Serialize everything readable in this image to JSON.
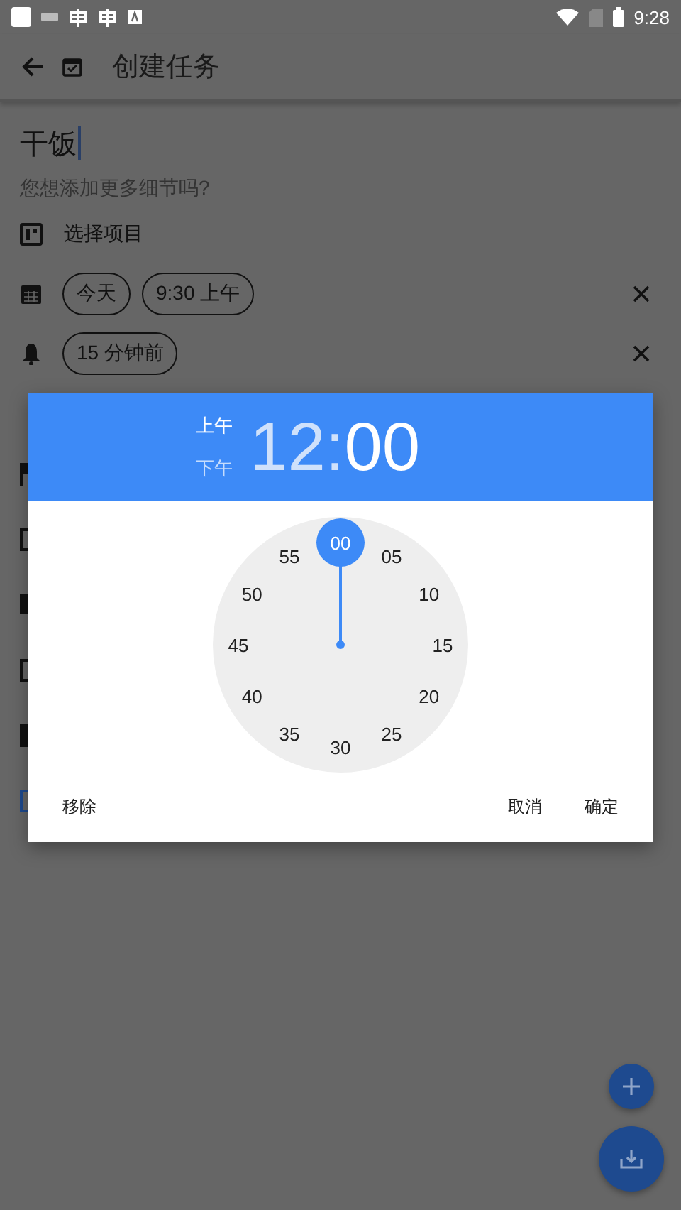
{
  "status_bar": {
    "time": "9:28"
  },
  "app_bar": {
    "title": "创建任务"
  },
  "task": {
    "title": "干饭",
    "notes_placeholder": "您想添加更多细节吗?"
  },
  "project": {
    "label": "选择项目"
  },
  "due": {
    "chips": [
      "今天",
      "9:30 上午"
    ]
  },
  "reminder": {
    "chips": [
      "15 分钟前"
    ]
  },
  "time_picker": {
    "periods": [
      {
        "label": "上午",
        "selected": true
      },
      {
        "label": "下午",
        "selected": false
      }
    ],
    "hour": {
      "text": "12",
      "selected": false
    },
    "separator": ":",
    "minute": {
      "text": "00",
      "selected": true
    },
    "dial": [
      {
        "label": "00",
        "selected": true
      },
      {
        "label": "05",
        "selected": false
      },
      {
        "label": "10",
        "selected": false
      },
      {
        "label": "15",
        "selected": false
      },
      {
        "label": "20",
        "selected": false
      },
      {
        "label": "25",
        "selected": false
      },
      {
        "label": "30",
        "selected": false
      },
      {
        "label": "35",
        "selected": false
      },
      {
        "label": "40",
        "selected": false
      },
      {
        "label": "45",
        "selected": false
      },
      {
        "label": "50",
        "selected": false
      },
      {
        "label": "55",
        "selected": false
      }
    ],
    "left_button": "移除",
    "right_buttons": [
      "取消",
      "确定"
    ]
  }
}
